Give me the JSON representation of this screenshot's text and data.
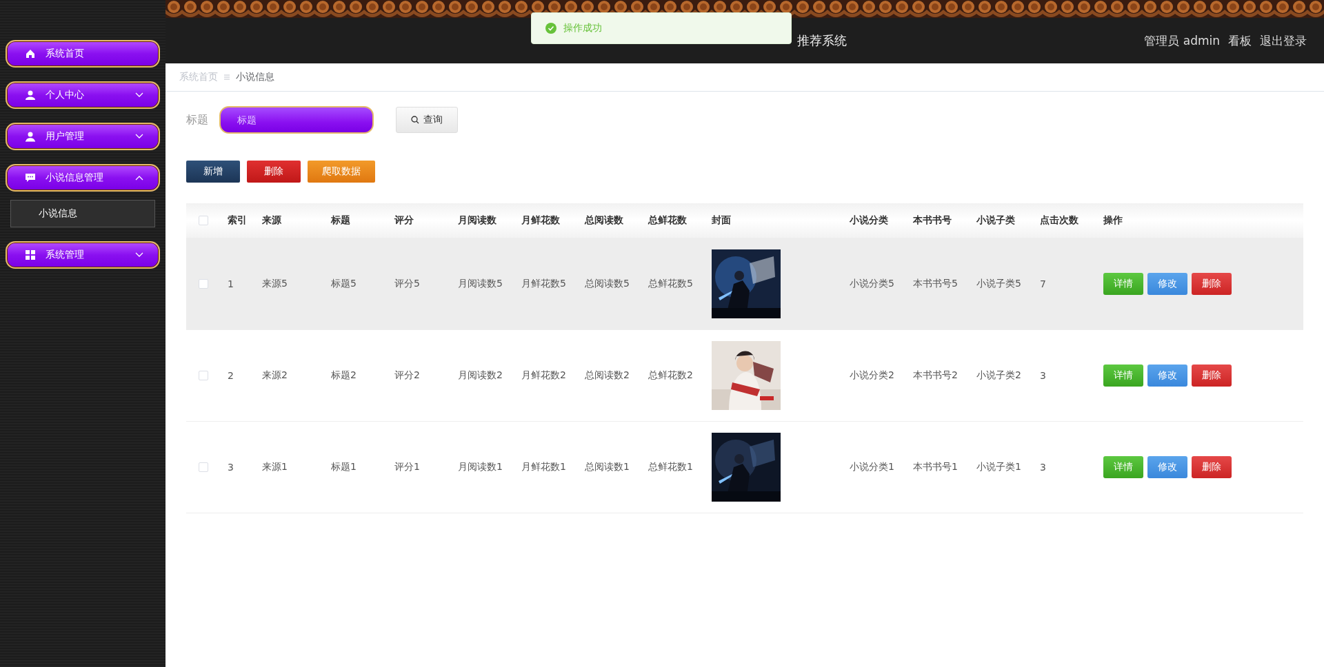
{
  "header": {
    "title": "推荐系统",
    "user": "管理员 admin",
    "links": [
      "看板",
      "退出登录"
    ]
  },
  "toast": {
    "message": "操作成功"
  },
  "sidebar": {
    "items": [
      {
        "label": "系统首页",
        "expandable": false
      },
      {
        "label": "个人中心",
        "expandable": true,
        "expanded": false
      },
      {
        "label": "用户管理",
        "expandable": true,
        "expanded": false
      },
      {
        "label": "小说信息管理",
        "expandable": true,
        "expanded": true,
        "children": [
          {
            "label": "小说信息",
            "selected": true
          }
        ]
      },
      {
        "label": "系统管理",
        "expandable": true,
        "expanded": false
      }
    ]
  },
  "breadcrumb": [
    "系统首页",
    "小说信息"
  ],
  "search": {
    "label": "标题",
    "placeholder": "标题",
    "button": "查询"
  },
  "actions": [
    {
      "label": "新增",
      "kind": "add"
    },
    {
      "label": "删除",
      "kind": "delete"
    },
    {
      "label": "爬取数据",
      "kind": "crawl"
    }
  ],
  "table": {
    "all_checked": false,
    "columns": [
      "索引",
      "来源",
      "标题",
      "评分",
      "月阅读数",
      "月鲜花数",
      "总阅读数",
      "总鲜花数",
      "封面",
      "小说分类",
      "本书书号",
      "小说子类",
      "点击次数",
      "操作"
    ],
    "rows": [
      {
        "checked": false,
        "highlighted": true,
        "cells": [
          "1",
          "来源5",
          "标题5",
          "评分5",
          "月阅读数5",
          "月鲜花数5",
          "总阅读数5",
          "总鲜花数5"
        ],
        "cover": {
          "kind": "picture"
        },
        "tail": [
          "小说分类5",
          "本书书号5",
          "小说子类5",
          "7"
        ],
        "buttons": [
          {
            "label": "详情",
            "kind": "detail"
          },
          {
            "label": "修改",
            "kind": "edit"
          },
          {
            "label": "删除",
            "kind": "delete"
          }
        ]
      },
      {
        "checked": false,
        "highlighted": false,
        "cells": [
          "2",
          "来源2",
          "标题2",
          "评分2",
          "月阅读数2",
          "月鲜花数2",
          "总阅读数2",
          "总鲜花数2"
        ],
        "cover": {
          "kind": "picture"
        },
        "tail": [
          "小说分类2",
          "本书书号2",
          "小说子类2",
          "3"
        ],
        "buttons": [
          {
            "label": "详情",
            "kind": "detail"
          },
          {
            "label": "修改",
            "kind": "edit"
          },
          {
            "label": "删除",
            "kind": "delete"
          }
        ]
      },
      {
        "checked": false,
        "highlighted": false,
        "cells": [
          "3",
          "来源1",
          "标题1",
          "评分1",
          "月阅读数1",
          "月鲜花数1",
          "总阅读数1",
          "总鲜花数1"
        ],
        "cover": {
          "kind": "picture"
        },
        "tail": [
          "小说分类1",
          "本书书号1",
          "小说子类1",
          "3"
        ],
        "buttons": [
          {
            "label": "详情",
            "kind": "detail"
          },
          {
            "label": "修改",
            "kind": "edit"
          },
          {
            "label": "删除",
            "kind": "delete"
          }
        ]
      }
    ]
  }
}
